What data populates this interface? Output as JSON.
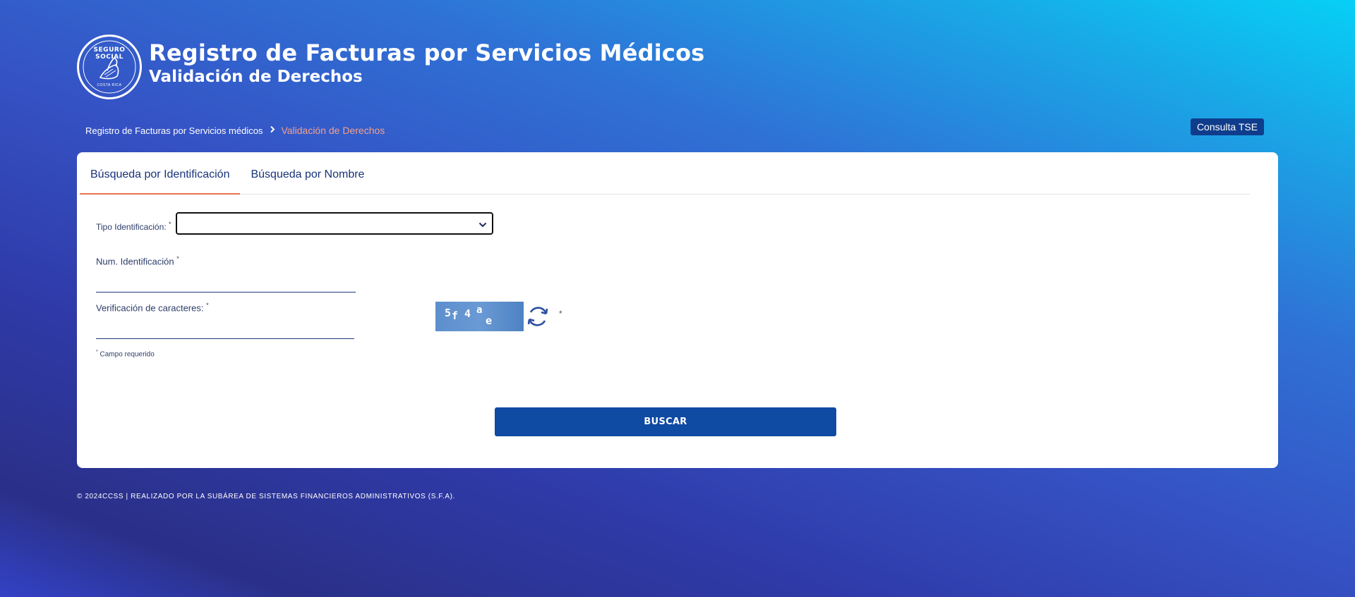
{
  "header": {
    "logo_text": "SEGURO SOCIAL",
    "logo_subtext": "COSTA RICA",
    "title": "Registro de Facturas por Servicios Médicos",
    "subtitle": "Validación de Derechos"
  },
  "breadcrumb": {
    "items": [
      "Registro de Facturas por Servicios médicos",
      "Validación de Derechos"
    ]
  },
  "toolbar": {
    "consulta_tse_label": "Consulta TSE"
  },
  "tabs": [
    {
      "label": "Búsqueda por Identificación",
      "active": true
    },
    {
      "label": "Búsqueda por Nombre",
      "active": false
    }
  ],
  "form": {
    "tipo_identificacion": {
      "label": "Tipo Identificación:",
      "required_mark": "*",
      "value": ""
    },
    "num_identificacion": {
      "label": "Num. Identificación",
      "required_mark": "*",
      "value": ""
    },
    "verificacion": {
      "label": "Verificación de caracteres:",
      "required_mark": "*",
      "value": ""
    },
    "captcha": {
      "chars": [
        "5",
        "f",
        "4",
        "a",
        "e"
      ],
      "required_mark": "*"
    },
    "required_note_mark": "*",
    "required_note": "Campo requerido",
    "submit_label": "BUSCAR"
  },
  "footer": {
    "text": "© 2024CCSS | REALIZADO POR LA SUBÁREA DE SISTEMAS FINANCIEROS ADMINISTRATIVOS (S.F.A)."
  },
  "colors": {
    "primary_button": "#0f4aa3",
    "tse_button": "#0f3d8c",
    "active_tab_underline": "#e8734a",
    "breadcrumb_current": "#f4a08a"
  },
  "icons": [
    "seguro-social-logo",
    "chevron-right-icon",
    "chevron-down-icon",
    "refresh-icon"
  ]
}
